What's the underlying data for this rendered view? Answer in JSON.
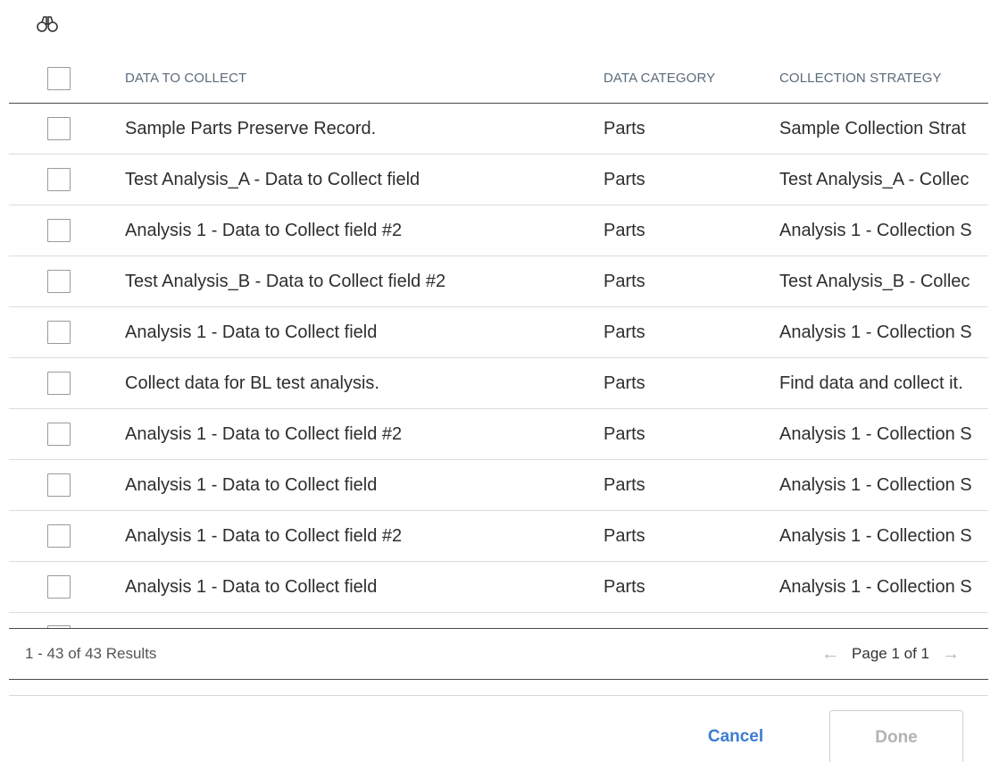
{
  "search": {
    "icon": "binoculars-icon"
  },
  "table": {
    "headers": [
      "DATA TO COLLECT",
      "DATA CATEGORY",
      "COLLECTION STRATEGY"
    ],
    "rows": [
      {
        "data_to_collect": "Sample Parts Preserve Record.",
        "category": "Parts",
        "strategy": "Sample Collection Strat"
      },
      {
        "data_to_collect": "Test Analysis_A - Data to Collect field",
        "category": "Parts",
        "strategy": "Test Analysis_A - Collec"
      },
      {
        "data_to_collect": "Analysis 1 - Data to Collect field #2",
        "category": "Parts",
        "strategy": "Analysis 1 - Collection S"
      },
      {
        "data_to_collect": "Test Analysis_B - Data to Collect field #2",
        "category": "Parts",
        "strategy": "Test Analysis_B - Collec"
      },
      {
        "data_to_collect": "Analysis 1 - Data to Collect field",
        "category": "Parts",
        "strategy": "Analysis 1 - Collection S"
      },
      {
        "data_to_collect": "Collect data for BL test analysis.",
        "category": "Parts",
        "strategy": "Find data and collect it."
      },
      {
        "data_to_collect": "Analysis 1 - Data to Collect field #2",
        "category": "Parts",
        "strategy": "Analysis 1 - Collection S"
      },
      {
        "data_to_collect": "Analysis 1 - Data to Collect field",
        "category": "Parts",
        "strategy": "Analysis 1 - Collection S"
      },
      {
        "data_to_collect": "Analysis 1 - Data to Collect field #2",
        "category": "Parts",
        "strategy": "Analysis 1 - Collection S"
      },
      {
        "data_to_collect": "Analysis 1 - Data to Collect field",
        "category": "Parts",
        "strategy": "Analysis 1 - Collection S"
      }
    ]
  },
  "pager": {
    "results": "1 - 43 of 43 Results",
    "page_label": "Page 1 of 1",
    "prev_icon": "arrow-left-icon",
    "next_icon": "arrow-right-icon"
  },
  "actions": {
    "cancel": "Cancel",
    "done": "Done"
  },
  "colors": {
    "accent": "#3c7dd1",
    "header_text": "#5b6b7a",
    "disabled_text": "#b3b3b3"
  }
}
